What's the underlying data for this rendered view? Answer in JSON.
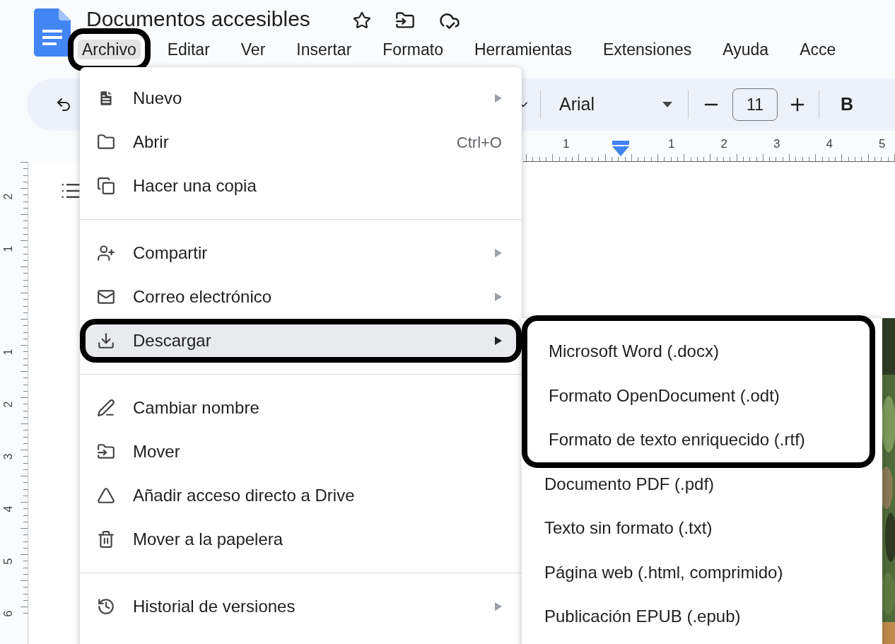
{
  "document": {
    "title": "Documentos accesibles"
  },
  "menubar": [
    {
      "label": "Archivo",
      "selected": true,
      "circled": true
    },
    {
      "label": "Editar",
      "selected": false,
      "circled": false
    },
    {
      "label": "Ver",
      "selected": false,
      "circled": false
    },
    {
      "label": "Insertar",
      "selected": false,
      "circled": false
    },
    {
      "label": "Formato",
      "selected": false,
      "circled": false
    },
    {
      "label": "Herramientas",
      "selected": false,
      "circled": false
    },
    {
      "label": "Extensiones",
      "selected": false,
      "circled": false
    },
    {
      "label": "Ayuda",
      "selected": false,
      "circled": false
    },
    {
      "label": "Acce",
      "selected": false,
      "circled": false
    }
  ],
  "toolbar": {
    "font": "Arial",
    "font_size": "11",
    "bold": "B"
  },
  "ruler": {
    "top_marks": [
      "1",
      "1",
      "2",
      "3",
      "4",
      "5"
    ],
    "side_marks": [
      "2",
      "1",
      "1",
      "2",
      "3",
      "4",
      "5",
      "6"
    ]
  },
  "file_menu": {
    "groups": [
      [
        {
          "label": "Nuevo",
          "submenu": true,
          "selected": false,
          "circled": false
        },
        {
          "label": "Abrir",
          "shortcut": "Ctrl+O",
          "submenu": false,
          "selected": false,
          "circled": false
        },
        {
          "label": "Hacer una copia",
          "submenu": false,
          "selected": false,
          "circled": false
        }
      ],
      [
        {
          "label": "Compartir",
          "submenu": true,
          "selected": false,
          "circled": false
        },
        {
          "label": "Correo electrónico",
          "submenu": true,
          "selected": false,
          "circled": false
        },
        {
          "label": "Descargar",
          "submenu": true,
          "selected": true,
          "circled": true
        }
      ],
      [
        {
          "label": "Cambiar nombre",
          "submenu": false,
          "selected": false,
          "circled": false
        },
        {
          "label": "Mover",
          "submenu": false,
          "selected": false,
          "circled": false
        },
        {
          "label": "Añadir acceso directo a Drive",
          "submenu": false,
          "selected": false,
          "circled": false
        },
        {
          "label": "Mover a la papelera",
          "submenu": false,
          "selected": false,
          "circled": false
        }
      ],
      [
        {
          "label": "Historial de versiones",
          "submenu": true,
          "selected": false,
          "circled": false
        }
      ]
    ]
  },
  "download_menu": {
    "items": [
      {
        "label": "Microsoft Word (.docx)",
        "circled": true
      },
      {
        "label": "Formato OpenDocument (.odt)",
        "circled": true
      },
      {
        "label": "Formato de texto enriquecido (.rtf)",
        "circled": true
      },
      {
        "label": "Documento PDF (.pdf)",
        "circled": false
      },
      {
        "label": "Texto sin formato (.txt)",
        "circled": false
      },
      {
        "label": "Página web (.html, comprimido)",
        "circled": false
      },
      {
        "label": "Publicación EPUB (.epub)",
        "circled": false
      }
    ]
  }
}
